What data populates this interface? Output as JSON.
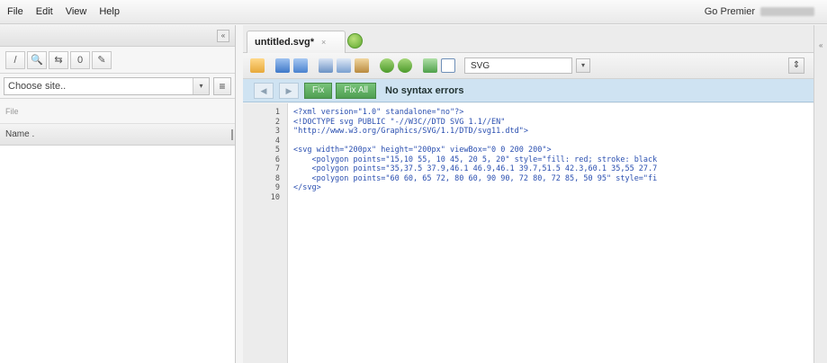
{
  "menu": {
    "items": [
      "File",
      "Edit",
      "View",
      "Help"
    ],
    "premier": "Go Premier",
    "user": ""
  },
  "left_panel": {
    "collapse_glyph": "«",
    "tools": [
      "/",
      "🔍",
      "⇆",
      "0",
      "✎"
    ],
    "site_select": {
      "value": "Choose site..",
      "arrow": "▾"
    },
    "list_glyph": "≡",
    "file_label": "File",
    "name_header": "Name ."
  },
  "tabs": [
    {
      "title": "untitled.svg*",
      "close": "×"
    }
  ],
  "toolbar": {
    "language": "SVG",
    "lang_arrow": "▾",
    "right_glyph": "⇕",
    "icons": [
      "folder-icon",
      "save-icon",
      "save-all-icon",
      "cut-icon",
      "copy-icon",
      "paste-icon",
      "undo-icon",
      "redo-icon",
      "preview-icon",
      "window-icon"
    ]
  },
  "status": {
    "prev": "◀",
    "next": "▶",
    "fix": "Fix",
    "fix_all": "Fix All",
    "message": "No syntax errors"
  },
  "code": {
    "line_numbers": [
      "1",
      "2",
      "3",
      "4",
      "5",
      "6",
      "7",
      "8",
      "9",
      "10"
    ],
    "lines": [
      "<?xml version=\"1.0\" standalone=\"no\"?>",
      "<!DOCTYPE svg PUBLIC \"-//W3C//DTD SVG 1.1//EN\"",
      "\"http://www.w3.org/Graphics/SVG/1.1/DTD/svg11.dtd\">",
      "",
      "<svg width=\"200px\" height=\"200px\" viewBox=\"0 0 200 200\">",
      "    <polygon points=\"15,10 55, 10 45, 20 5, 20\" style=\"fill: red; stroke: black",
      "    <polygon points=\"35,37.5 37.9,46.1 46.9,46.1 39.7,51.5 42.3,60.1 35,55 27.7",
      "    <polygon points=\"60 60, 65 72, 80 60, 90 90, 72 80, 72 85, 50 95\" style=\"fi",
      "</svg>",
      ""
    ]
  },
  "colors": {
    "status_bg": "#cfe3f2",
    "fix_green": "#5aa95c",
    "code_blue": "#2a4fb0",
    "new_tab_green": "#5fa82f"
  }
}
